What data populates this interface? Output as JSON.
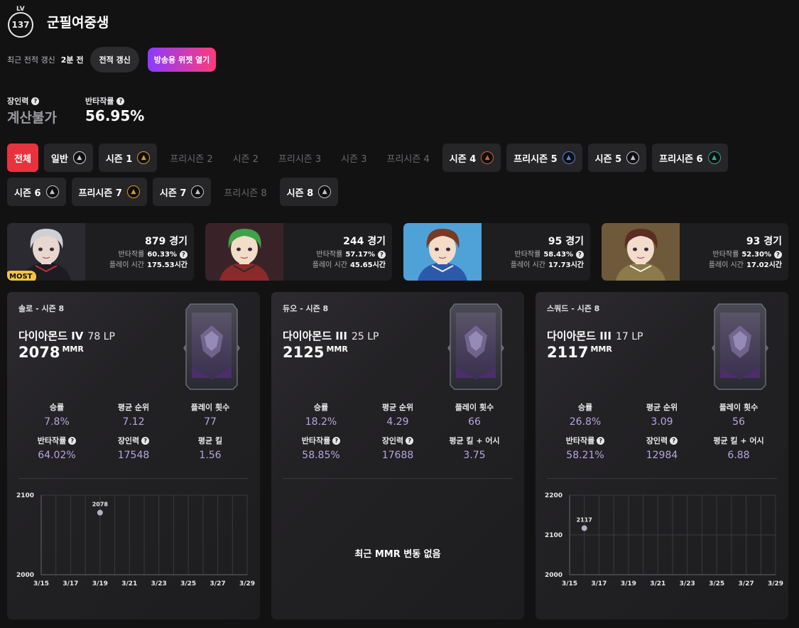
{
  "profile": {
    "level_label": "LV",
    "level": "137",
    "nickname": "군필여중생",
    "update_label": "최근 전적 갱신",
    "update_time": "2분 전",
    "refresh_button": "전적 갱신",
    "widget_button": "방송용 위젯 열기"
  },
  "summary": {
    "mmr_power_label": "장인력",
    "mmr_power_value": "계산불가",
    "avoid_rate_label": "반타작률",
    "avoid_rate_value": "56.95%"
  },
  "season_chips": [
    {
      "label": "전체",
      "state": "active",
      "icon": ""
    },
    {
      "label": "일반",
      "state": "normal",
      "icon": "iron"
    },
    {
      "label": "시즌 1",
      "state": "normal",
      "icon": "gold"
    },
    {
      "label": "프리시즌 2",
      "state": "disabled",
      "icon": ""
    },
    {
      "label": "시즌 2",
      "state": "disabled",
      "icon": ""
    },
    {
      "label": "프리시즌 3",
      "state": "disabled",
      "icon": ""
    },
    {
      "label": "시즌 3",
      "state": "disabled",
      "icon": ""
    },
    {
      "label": "프리시즌 4",
      "state": "disabled",
      "icon": ""
    },
    {
      "label": "시즌 4",
      "state": "normal",
      "icon": "bronze"
    },
    {
      "label": "프리시즌 5",
      "state": "normal",
      "icon": "blue"
    },
    {
      "label": "시즌 5",
      "state": "normal",
      "icon": "silver"
    },
    {
      "label": "프리시즌 6",
      "state": "normal",
      "icon": "green"
    },
    {
      "label": "시즌 6",
      "state": "normal",
      "icon": "silver"
    },
    {
      "label": "프리시즌 7",
      "state": "normal",
      "icon": "gold"
    },
    {
      "label": "시즌 7",
      "state": "normal",
      "icon": "silver"
    },
    {
      "label": "프리시즌 8",
      "state": "disabled",
      "icon": ""
    },
    {
      "label": "시즌 8",
      "state": "normal",
      "icon": "silver"
    }
  ],
  "characters": [
    {
      "games": "879 경기",
      "avoid_label": "반타작률",
      "avoid": "60.33%",
      "time_label": "플레이 시간",
      "time": "175.53시간",
      "most": "MOST"
    },
    {
      "games": "244 경기",
      "avoid_label": "반타작률",
      "avoid": "57.17%",
      "time_label": "플레이 시간",
      "time": "45.65시간"
    },
    {
      "games": "95 경기",
      "avoid_label": "반타작률",
      "avoid": "58.43%",
      "time_label": "플레이 시간",
      "time": "17.73시간"
    },
    {
      "games": "93 경기",
      "avoid_label": "반타작률",
      "avoid": "52.30%",
      "time_label": "플레이 시간",
      "time": "17.02시간"
    }
  ],
  "panels": [
    {
      "mode": "솔로 - 시즌 8",
      "tier": "다이아몬드 IV",
      "lp": "78 LP",
      "mmr": "2078",
      "mmr_unit": "MMR",
      "stats": [
        {
          "label": "승률",
          "value": "7.8%",
          "help": false
        },
        {
          "label": "평균 순위",
          "value": "7.12",
          "help": false
        },
        {
          "label": "플레이 횟수",
          "value": "77",
          "help": false
        },
        {
          "label": "반타작률",
          "value": "64.02%",
          "help": true
        },
        {
          "label": "장인력",
          "value": "17548",
          "help": true
        },
        {
          "label": "평균 킬",
          "value": "1.56",
          "help": false
        }
      ],
      "no_change": ""
    },
    {
      "mode": "듀오 - 시즌 8",
      "tier": "다이아몬드 III",
      "lp": "25 LP",
      "mmr": "2125",
      "mmr_unit": "MMR",
      "stats": [
        {
          "label": "승률",
          "value": "18.2%",
          "help": false
        },
        {
          "label": "평균 순위",
          "value": "4.29",
          "help": false
        },
        {
          "label": "플레이 횟수",
          "value": "66",
          "help": false
        },
        {
          "label": "반타작률",
          "value": "58.85%",
          "help": true
        },
        {
          "label": "장인력",
          "value": "17688",
          "help": true
        },
        {
          "label": "평균 킬 + 어시",
          "value": "3.75",
          "help": false
        }
      ],
      "no_change": "최근 MMR 변동 없음"
    },
    {
      "mode": "스쿼드 - 시즌 8",
      "tier": "다이아몬드 III",
      "lp": "17 LP",
      "mmr": "2117",
      "mmr_unit": "MMR",
      "stats": [
        {
          "label": "승률",
          "value": "26.8%",
          "help": false
        },
        {
          "label": "평균 순위",
          "value": "3.09",
          "help": false
        },
        {
          "label": "플레이 횟수",
          "value": "56",
          "help": false
        },
        {
          "label": "반타작률",
          "value": "58.21%",
          "help": true
        },
        {
          "label": "장인력",
          "value": "12984",
          "help": true
        },
        {
          "label": "평균 킬 + 어시",
          "value": "6.88",
          "help": false
        }
      ],
      "no_change": ""
    }
  ],
  "chart_data": [
    {
      "type": "scatter",
      "x_ticks": [
        "3/15",
        "3/17",
        "3/19",
        "3/21",
        "3/23",
        "3/25",
        "3/27",
        "3/29"
      ],
      "y_ticks": [
        "2000",
        "2100"
      ],
      "ylim": [
        2000,
        2100
      ],
      "points": [
        {
          "x": "3/19",
          "y": 2078,
          "label": "2078"
        }
      ],
      "grid": true
    },
    {
      "type": "scatter",
      "x_ticks": [
        "3/15",
        "3/17",
        "3/19",
        "3/21",
        "3/23",
        "3/25",
        "3/27",
        "3/29"
      ],
      "y_ticks": [
        "2000",
        "2100",
        "2200"
      ],
      "ylim": [
        2000,
        2200
      ],
      "points": [
        {
          "x": "3/16",
          "y": 2117,
          "label": "2117"
        }
      ],
      "grid": true
    }
  ],
  "colors": {
    "accent_red": "#e8333e",
    "stat_value": "#b7a6de",
    "most_badge": "#f5c542",
    "point": "#b4b0be"
  }
}
